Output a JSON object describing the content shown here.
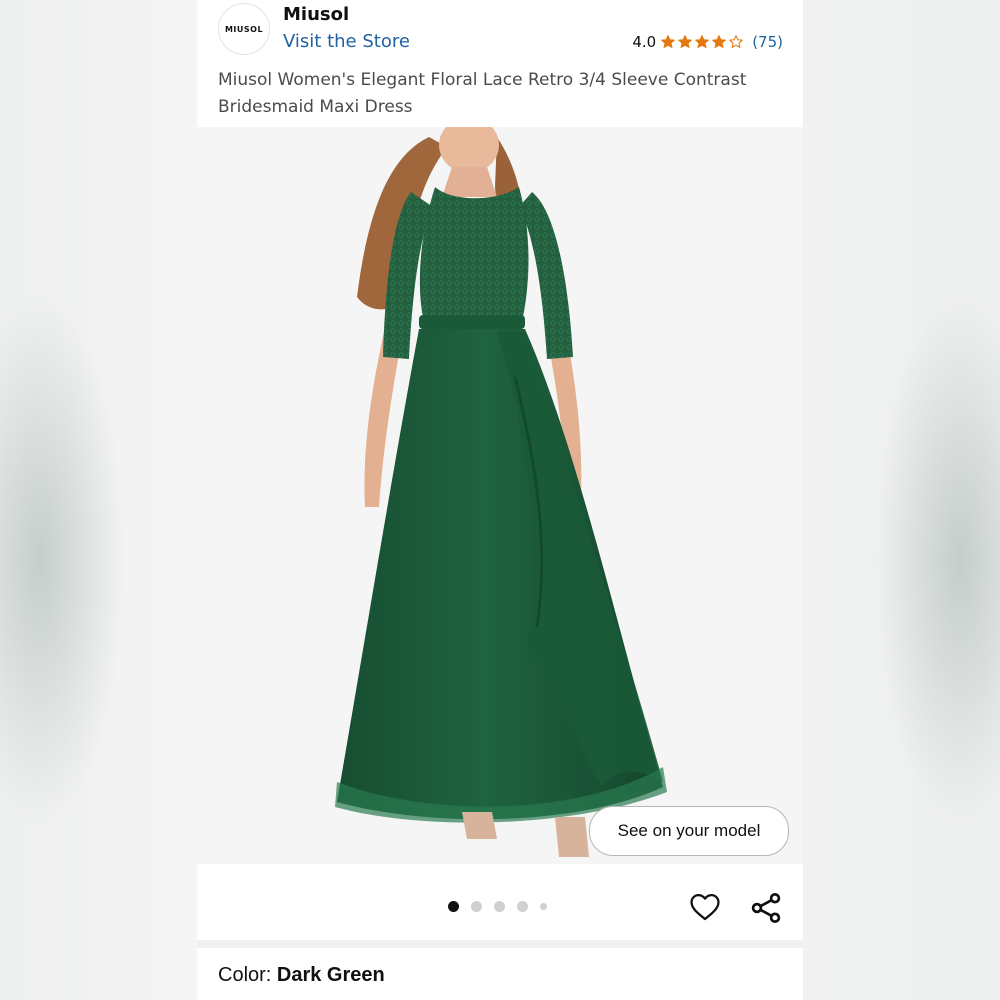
{
  "brand": {
    "logo_text": "MIUSOL",
    "name": "Miusol",
    "store_link": "Visit the Store"
  },
  "rating": {
    "value": "4.0",
    "stars": 4,
    "max_stars": 5,
    "count": "(75)",
    "star_color": "#e47911"
  },
  "product": {
    "title": "Miusol Women's Elegant Floral Lace Retro 3/4 Sleeve Contrast Bridesmaid Maxi Dress"
  },
  "gallery": {
    "see_on_model_label": "See on your model",
    "image_count": 5,
    "active_index": 0,
    "dress_color": "#1d5a3b"
  },
  "actions": {
    "wishlist_icon": "heart-icon",
    "share_icon": "share-icon"
  },
  "variant": {
    "color_label": "Color: ",
    "color_value": "Dark Green"
  }
}
